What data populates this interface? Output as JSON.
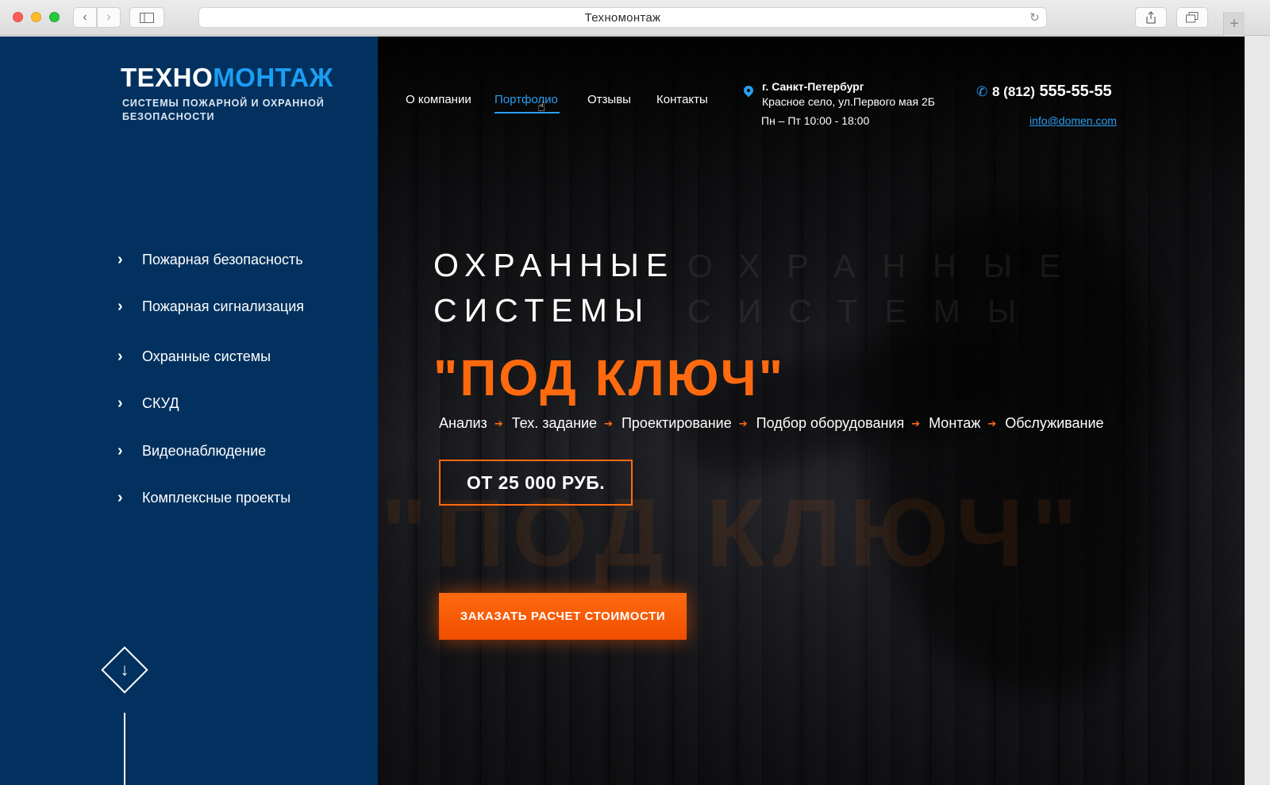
{
  "browser": {
    "title": "Техномонтаж",
    "reload_icon": "reload-icon",
    "new_tab": "+"
  },
  "colors": {
    "brand_blue": "#1c9ef3",
    "sidebar_bg": "#02315f",
    "accent_orange": "#ff6a0f"
  },
  "logo": {
    "part1": "ТЕХНО",
    "part2": "МОНТАЖ",
    "tagline": "СИСТЕМЫ ПОЖАРНОЙ И ОХРАННОЙ БЕЗОПАСНОСТИ"
  },
  "sidebar": {
    "items": [
      {
        "label": "Пожарная безопасность"
      },
      {
        "label": "Пожарная сигнализация"
      },
      {
        "label": "Охранные системы"
      },
      {
        "label": "СКУД"
      },
      {
        "label": "Видеонаблюдение"
      },
      {
        "label": "Комплексные проекты"
      }
    ]
  },
  "nav": {
    "links": [
      {
        "label": "О компании"
      },
      {
        "label": "Портфолио",
        "active": true
      },
      {
        "label": "Отзывы"
      },
      {
        "label": "Контакты"
      }
    ]
  },
  "address": {
    "city": "г. Санкт-Петербург",
    "street": "Красное село, ул.Первого мая 2Б",
    "hours": "Пн – Пт 10:00 - 18:00"
  },
  "contact": {
    "phone_prefix": "8 (812)",
    "phone_number": "555-55-55",
    "email": "info@domen.com"
  },
  "hero": {
    "line1": "ОХРАННЫЕ",
    "line2": "СИСТЕМЫ",
    "turnkey": "\"ПОД КЛЮЧ\"",
    "steps": [
      "Анализ",
      "Тех. задание",
      "Проектирование",
      "Подбор оборудования",
      "Монтаж",
      "Обслуживание"
    ],
    "price": "ОТ  25 000 РУБ.",
    "cta_label": "ЗАКАЗАТЬ РАСЧЕТ СТОИМОСТИ"
  }
}
